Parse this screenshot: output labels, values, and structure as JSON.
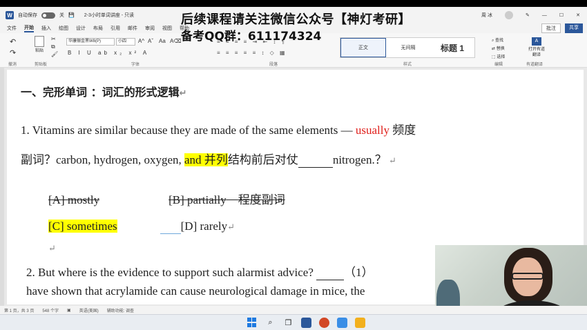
{
  "titlebar": {
    "app_icon": "W",
    "autosave_label": "自动保存",
    "autosave_state": "关",
    "doc_title": "2-3小时单词讲座 - 只读",
    "user_name": "周 冰"
  },
  "ribbon_tabs": {
    "items": [
      "文件",
      "开始",
      "插入",
      "绘图",
      "设计",
      "布局",
      "引用",
      "邮件",
      "审阅",
      "视图",
      "帮助"
    ],
    "active": "开始",
    "comment_label": "批注",
    "share_label": "共享"
  },
  "ribbon": {
    "paste_label": "粘贴",
    "font_name": "华康俪金黑W8(P)",
    "font_size": "小四",
    "format_glyphs": "B I U ab x₂ x² A",
    "para_glyphs_top": "≡ ≡ ≡ ≡ ⇥ ⇤ ↕ ¶",
    "para_glyphs_bottom": "≡ ≡ ≡ ≡ ≡ ↕ ◇ ▦",
    "style_normal": "正文",
    "style_nospacing": "无间隔",
    "style_heading1": "标题 1",
    "find_label": "查找",
    "replace_label": "替换",
    "select_label": "选择",
    "dict_label": "打开有道翻译",
    "groups": [
      "撤消",
      "剪贴板",
      "字体",
      "段落",
      "样式",
      "编辑",
      "有道翻译"
    ]
  },
  "watermark": {
    "line1": "后续课程请关注微信公众号【神灯考研】",
    "line2": "备考QQ群：611174324"
  },
  "document": {
    "heading": "一、完形单词 ：词汇的形式逻辑",
    "q1_part1": "1. Vitamins are similar because they are made of the same elements  —  ",
    "q1_red": "usually",
    "q1_note": "  频度",
    "q1_line2_a": "副词？carbon, hydrogen, oxygen, ",
    "q1_line2_hl": "and 并列",
    "q1_line2_b": "结构前后对仗",
    "q1_line2_c": "nitrogen.？",
    "opt_a": "[A] mostly",
    "opt_b": "[B] partially",
    "opt_note": "程度副词",
    "opt_c": "[C] sometimes",
    "opt_d": "[D] rarely",
    "q2_line1": "2. But where is the evidence to support such alarmist advice?  ",
    "q2_paren": "（1）",
    "q2_line2": "have shown that acrylamide can cause neurological damage in mice, the"
  },
  "statusbar": {
    "page": "第 1 页，共 3 页",
    "words": "548 个字",
    "lang": "英语(美国)",
    "accessibility": "辅助功能: 调查"
  },
  "colors": {
    "accent": "#2b579a",
    "red_text": "#e0201c",
    "highlight": "#ffff00"
  }
}
